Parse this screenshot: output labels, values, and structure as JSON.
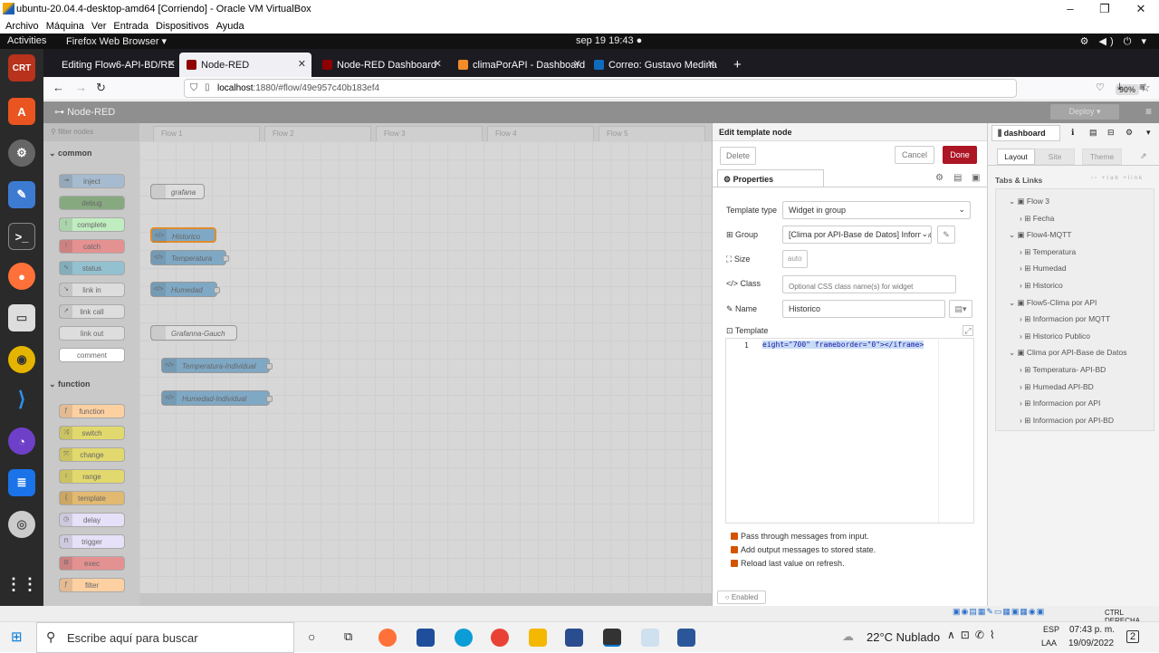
{
  "vbox": {
    "title": "ubuntu-20.04.4-desktop-amd64 [Corriendo] - Oracle VM VirtualBox",
    "menu": [
      "Archivo",
      "Máquina",
      "Ver",
      "Entrada",
      "Dispositivos",
      "Ayuda"
    ],
    "minimize": "–",
    "restore": "❐",
    "close": "✕"
  },
  "gnome": {
    "activities": "Activities",
    "app": "Firefox Web Browser ▾",
    "clock": "sep 19  19:43  ●",
    "tray": "⚙ ◀) ⏻ ▾"
  },
  "tabs": [
    {
      "label": "Editing Flow6-API-BD/RE",
      "close": "✕"
    },
    {
      "label": "Node-RED",
      "close": "✕"
    },
    {
      "label": "Node-RED Dashboard",
      "close": "✕"
    },
    {
      "label": "climaPorAPI - Dashboard",
      "close": "✕"
    },
    {
      "label": "Correo: Gustavo Medina",
      "close": "✕"
    }
  ],
  "newtab": "+",
  "nav": {
    "back": "←",
    "forward": "→",
    "reload": "↻",
    "host": "localhost",
    "path": ":1880/#flow/49e957c40b183ef4",
    "zoom": "90%",
    "star": "☆"
  },
  "nodered": {
    "brand": "Node-RED",
    "deploy": "Deploy  ▾",
    "menu": "≡"
  },
  "palette": {
    "filter": "filter nodes",
    "cat_common": "common",
    "cat_function": "function",
    "common": [
      "inject",
      "debug",
      "complete",
      "catch",
      "status",
      "link in",
      "link call",
      "link out",
      "comment"
    ],
    "function": [
      "function",
      "switch",
      "change",
      "range",
      "template",
      "delay",
      "trigger",
      "exec",
      "filter"
    ]
  },
  "flowtabs": [
    "Flow 1",
    "Flow 2",
    "Flow 3",
    "Flow 4",
    "Flow 5"
  ],
  "wsnodes": [
    "grafana",
    "Historico",
    "Temperatura",
    "Humedad",
    "Grafanna-Gauch",
    "Temperatura-Individual",
    "Humedad-Individual"
  ],
  "editor": {
    "title": "Edit template node",
    "delete": "Delete",
    "cancel": "Cancel",
    "done": "Done",
    "tab": "Properties",
    "template_type_label": "Template type",
    "template_type": "Widget in group",
    "group_label": "Group",
    "group": "[Clima por API-Base de Datos] Informac",
    "size_label": "Size",
    "size": "auto",
    "class_label": "Class",
    "class_placeholder": "Optional CSS class name(s) for widget",
    "name_label": "Name",
    "name": "Historico",
    "template_label": "Template",
    "line_no": "1",
    "code": "eight=\"700\" frameborder=\"0\"></iframe>",
    "opt1": "Pass through messages from input.",
    "opt2": "Add output messages to stored state.",
    "opt3": "Reload last value on refresh.",
    "enabled": "Enabled"
  },
  "sidebar": {
    "tab": "dashboard",
    "subtabs": [
      "Layout",
      "Site",
      "Theme"
    ],
    "section": "Tabs & Links",
    "tree": [
      {
        "t": "Flow 3",
        "lvl": 0
      },
      {
        "t": "Fecha",
        "lvl": 1
      },
      {
        "t": "Flow4-MQTT",
        "lvl": 0
      },
      {
        "t": "Temperatura",
        "lvl": 1
      },
      {
        "t": "Humedad",
        "lvl": 1
      },
      {
        "t": "Historico",
        "lvl": 1
      },
      {
        "t": "Flow5-Clima por API",
        "lvl": 0
      },
      {
        "t": "Informacion por MQTT",
        "lvl": 1
      },
      {
        "t": "Historico Publico",
        "lvl": 1
      },
      {
        "t": "Clima por API-Base de Datos",
        "lvl": 0
      },
      {
        "t": "Temperatura- API-BD",
        "lvl": 1
      },
      {
        "t": "Humedad API-BD",
        "lvl": 1
      },
      {
        "t": "Informacion por API",
        "lvl": 1
      },
      {
        "t": "Informacion por API-BD",
        "lvl": 1
      }
    ]
  },
  "vbstatus": "CTRL DERECHA",
  "taskbar": {
    "search": "Escribe aquí para buscar",
    "weather": "22°C  Nublado",
    "lang1": "ESP",
    "lang2": "LAA",
    "time": "07:43 p. m.",
    "date": "19/09/2022",
    "notif": "2"
  }
}
